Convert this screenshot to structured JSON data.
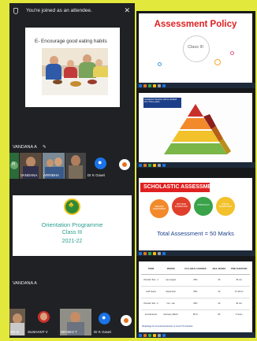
{
  "banner": {
    "text": "You're joined as an attendee."
  },
  "left_panel": {
    "slide1": {
      "title": "E- Encourage good eating habits"
    },
    "user_label_1": "VANDANA A",
    "row1_tiles": [
      "VANDANA",
      "ARRIBHA",
      "Dr K Gowri"
    ],
    "slide2": {
      "title": "Orientation Programme",
      "class": "Class III",
      "year": "2021-22"
    },
    "user_label_2": "VANDANA A",
    "row2_tiles": [
      "MA S",
      "SUSHANT V",
      "SRABHI T",
      "Dr K Gowri"
    ]
  },
  "right_panel": {
    "slide1": {
      "title": "Assessment Policy",
      "subtitle": "Class III"
    },
    "slide2": {
      "heading": "Academic Session will be divided into Three parts"
    },
    "slide3": {
      "title": "SCHOLASTIC ASSESSMENT",
      "circles": [
        "PERIODIC ASSESSMENT",
        "MID TERM EXAMINATION",
        "PORTFOLIO",
        "ANNUAL EXAMINATION"
      ],
      "total": "Total Assessment = 50 Marks"
    },
    "slide4": {
      "headers": [
        "TERM",
        "PERIOD",
        "SYLLABUS COVERED",
        "MAX. MARKS",
        "TIME DURATION"
      ],
      "rows": [
        [
          "Periodic Test - 1",
          "Apr-August",
          "25%",
          "30",
          "45 min"
        ],
        [
          "Half Yearly",
          "September",
          "50%",
          "40",
          "1h 30min"
        ],
        [
          "Periodic Test - 2",
          "Oct - Jan",
          "25%",
          "20",
          "45 min"
        ],
        [
          "Annual Exam",
          "February-March",
          "80 %",
          "80",
          "3 hours"
        ]
      ],
      "footnote": "Weightage for Annual Examination & Covid TO Activities"
    }
  },
  "colors": {
    "background": "#e3e83c",
    "panel": "#202124",
    "accent_red": "#e02020",
    "accent_blue": "#1a73e8"
  }
}
